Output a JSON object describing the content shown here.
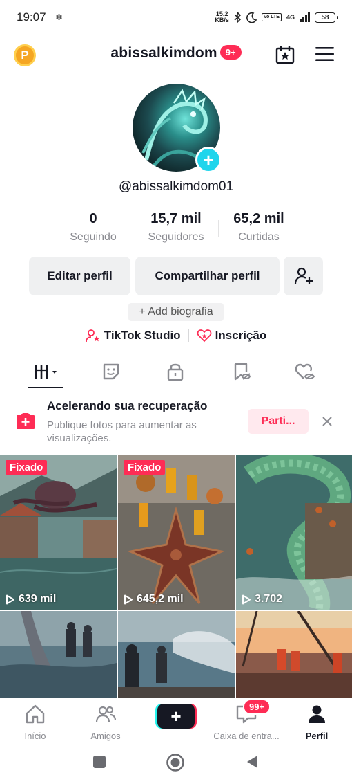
{
  "status_bar": {
    "time": "19:07",
    "speed_value": "15,2",
    "speed_unit": "KB/s",
    "volte": "Vo LTE",
    "network": "4G",
    "battery": "58"
  },
  "header": {
    "username": "abissalkimdom",
    "notification_badge": "9+",
    "points_icon_letter": "P"
  },
  "profile": {
    "handle": "@abissalkimdom01",
    "stats": [
      {
        "value": "0",
        "label": "Seguindo"
      },
      {
        "value": "15,7 mil",
        "label": "Seguidores"
      },
      {
        "value": "65,2 mil",
        "label": "Curtidas"
      }
    ],
    "edit_button": "Editar perfil",
    "share_button": "Compartilhar perfil",
    "add_bio": "+ Add biografia",
    "studio_link": "TikTok Studio",
    "subscription_link": "Inscrição"
  },
  "banner": {
    "title": "Acelerando sua recuperação",
    "text": "Publique fotos para aumentar as visualizações.",
    "cta": "Parti..."
  },
  "videos": [
    {
      "pinned_label": "Fixado",
      "views": "639 mil"
    },
    {
      "pinned_label": "Fixado",
      "views": "645,2 mil"
    },
    {
      "pinned_label": "",
      "views": "3.702"
    },
    {
      "pinned_label": "",
      "views": ""
    },
    {
      "pinned_label": "",
      "views": ""
    },
    {
      "pinned_label": "",
      "views": ""
    }
  ],
  "bottom_nav": {
    "home": "Início",
    "friends": "Amigos",
    "inbox": "Caixa de entra...",
    "inbox_badge": "99+",
    "profile": "Perfil"
  },
  "colors": {
    "accent": "#fe2c55",
    "cyan": "#20d5ec",
    "text": "#161823",
    "muted": "#8a8b91"
  }
}
